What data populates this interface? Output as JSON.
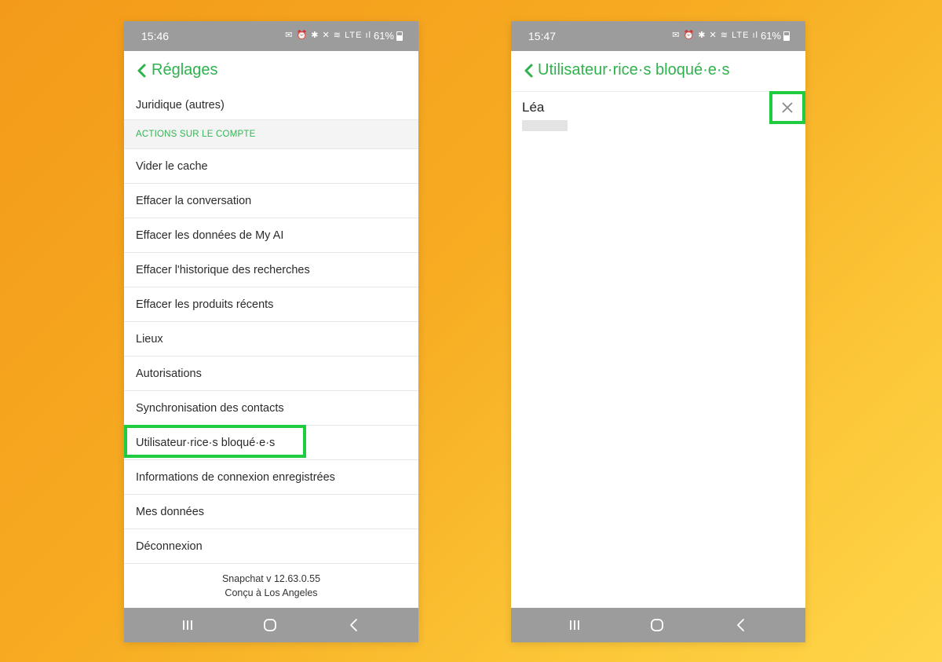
{
  "left_screen": {
    "status_bar": {
      "time": "15:46",
      "icons": "✉ ⏰ ✱ ✕ ≋ LTE ıl",
      "battery": "61%"
    },
    "header": {
      "title": "Réglages"
    },
    "rows": [
      {
        "label": "Juridique (autres)",
        "kind": "first"
      },
      {
        "label": "ACTIONS SUR LE COMPTE",
        "kind": "section"
      },
      {
        "label": "Vider le cache",
        "kind": "item"
      },
      {
        "label": "Effacer la conversation",
        "kind": "item"
      },
      {
        "label": "Effacer les données de My AI",
        "kind": "item"
      },
      {
        "label": "Effacer l'historique des recherches",
        "kind": "item"
      },
      {
        "label": "Effacer les produits récents",
        "kind": "item"
      },
      {
        "label": "Lieux",
        "kind": "item"
      },
      {
        "label": "Autorisations",
        "kind": "item"
      },
      {
        "label": "Synchronisation des contacts",
        "kind": "item"
      },
      {
        "label": "Utilisateur·rice·s bloqué·e·s",
        "kind": "item",
        "highlighted": true
      },
      {
        "label": "Informations de connexion enregistrées",
        "kind": "item"
      },
      {
        "label": "Mes données",
        "kind": "item"
      },
      {
        "label": "Déconnexion",
        "kind": "item"
      }
    ],
    "footer": {
      "version": "Snapchat v 12.63.0.55",
      "made_in": "Conçu à Los Angeles"
    }
  },
  "right_screen": {
    "status_bar": {
      "time": "15:47",
      "icons": "✉ ⏰ ✱ ✕ ≋ LTE ıl",
      "battery": "61%"
    },
    "header": {
      "title": "Utilisateur·rice·s bloqué·e·s"
    },
    "blocked_users": [
      {
        "name": "Léa"
      }
    ]
  },
  "colors": {
    "accent_green": "#2fb24c",
    "highlight_box": "#1fcc3f",
    "status_bar": "#9c9c9c",
    "background_orange": "#f7ac22"
  }
}
